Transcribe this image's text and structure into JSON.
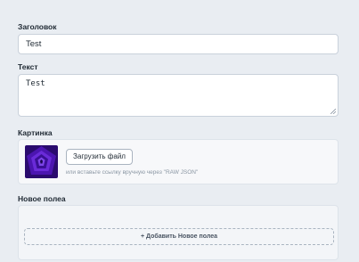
{
  "fields": {
    "title": {
      "label": "Заголовок",
      "value": "Test"
    },
    "text": {
      "label": "Текст",
      "value": "Test"
    },
    "image": {
      "label": "Картинка",
      "upload_label": "Загрузить файл",
      "hint": "или вставьте ссылку вручную через \"RAW JSON\"",
      "thumbnail_icon": "purple-spiral-image"
    },
    "new_field": {
      "label": "Новое полеа",
      "add_label": "+ Добавить Новое полеа"
    }
  },
  "colors": {
    "background": "#e9edf2",
    "thumbnail": "#6a2bd9"
  }
}
